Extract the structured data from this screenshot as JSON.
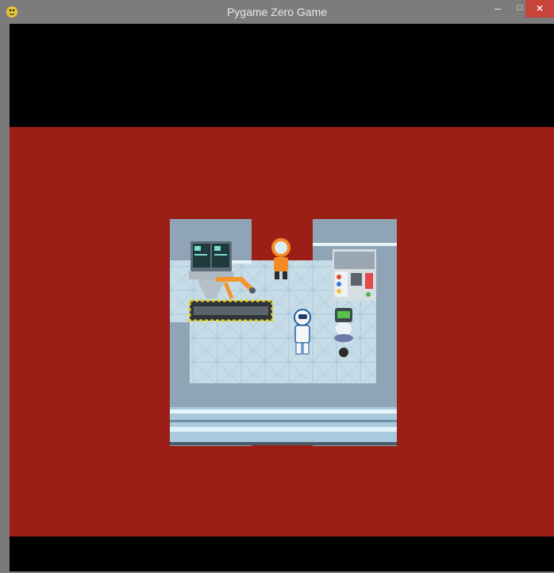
{
  "window": {
    "title": "Pygame Zero Game",
    "controls": {
      "minimize": "–",
      "maximize": "□",
      "close": "×"
    }
  },
  "game": {
    "background_color": "#000000",
    "field_color": "#9b1e17",
    "sprites": [
      "astronaut-orange",
      "astronaut-white",
      "robot",
      "robotic-arm",
      "conveyor-belt",
      "control-panel",
      "computer-console"
    ]
  }
}
